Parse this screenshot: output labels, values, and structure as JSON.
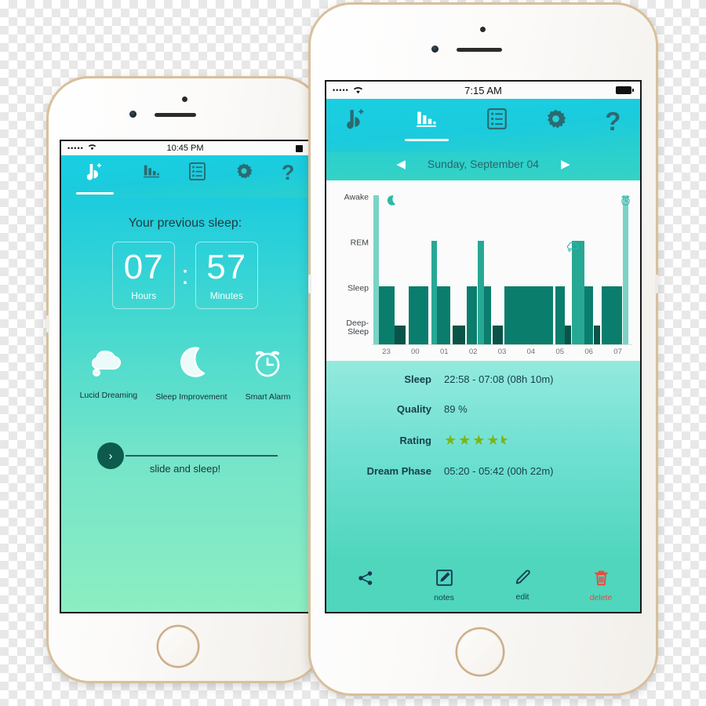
{
  "left_phone": {
    "status_bar": {
      "signal": "•••••",
      "wifi": "wifi-icon",
      "time": "10:45 PM",
      "battery": "battery-icon"
    },
    "nav": {
      "items": [
        {
          "name": "leaf-plus-icon",
          "label": "",
          "active": true
        },
        {
          "name": "bar-chart-icon",
          "label": "",
          "active": false
        },
        {
          "name": "list-icon",
          "label": "",
          "active": false
        },
        {
          "name": "gear-icon",
          "label": "",
          "active": false
        },
        {
          "name": "question-mark-icon",
          "label": "?",
          "active": false
        }
      ]
    },
    "home": {
      "title": "Your previous sleep:",
      "hours_value": "07",
      "hours_unit": "Hours",
      "separator": ":",
      "minutes_value": "57",
      "minutes_unit": "Minutes",
      "features": [
        {
          "icon": "thought-cloud-icon",
          "label": "Lucid Dreaming"
        },
        {
          "icon": "crescent-moon-icon",
          "label": "Sleep Improvement"
        },
        {
          "icon": "alarm-clock-icon",
          "label": "Smart Alarm"
        }
      ],
      "slider_label": "slide and sleep!",
      "slider_knob_icon": "chevron-right-icon"
    }
  },
  "right_phone": {
    "status_bar": {
      "signal": "•••••",
      "wifi": "wifi-icon",
      "time": "7:15 AM",
      "battery": "battery-icon"
    },
    "nav": {
      "items": [
        {
          "name": "leaf-plus-icon",
          "label": "",
          "active": false
        },
        {
          "name": "bar-chart-icon",
          "label": "",
          "active": true
        },
        {
          "name": "list-icon",
          "label": "",
          "active": false
        },
        {
          "name": "gear-icon",
          "label": "",
          "active": false
        },
        {
          "name": "question-mark-icon",
          "label": "?",
          "active": false
        }
      ]
    },
    "date_nav": {
      "prev_icon": "triangle-left-icon",
      "label": "Sunday, September 04",
      "next_icon": "triangle-right-icon"
    },
    "stats": [
      {
        "label": "Sleep",
        "value": "22:58 - 07:08  (08h 10m)",
        "type": "text"
      },
      {
        "label": "Quality",
        "value": "89 %",
        "type": "text"
      },
      {
        "label": "Rating",
        "value": "4.5",
        "type": "stars",
        "stars_full": 4,
        "stars_half": 1,
        "star_color": "#7cb518"
      },
      {
        "label": "Dream Phase",
        "value": "05:20 - 05:42  (00h 22m)",
        "type": "text"
      }
    ],
    "toolbar": [
      {
        "icon": "share-icon",
        "label": "",
        "danger": false
      },
      {
        "icon": "notes-icon",
        "label": "notes",
        "danger": false
      },
      {
        "icon": "pencil-icon",
        "label": "edit",
        "danger": false
      },
      {
        "icon": "trash-icon",
        "label": "delete",
        "danger": true
      }
    ],
    "chart_data": {
      "type": "bar",
      "title": "",
      "xlabel": "",
      "ylabel": "",
      "grid": false,
      "legend": null,
      "y_categories": [
        "Awake",
        "REM",
        "Sleep",
        "Deep-\nSleep"
      ],
      "y_levels": {
        "Awake": 4,
        "REM": 3,
        "Sleep": 2,
        "Deep-Sleep": 1
      },
      "x_ticks": [
        "23",
        "00",
        "01",
        "02",
        "03",
        "04",
        "05",
        "06",
        "07"
      ],
      "x_range": [
        22.9,
        7.25
      ],
      "colors": {
        "awake": "#7ad3c6",
        "rem": "#27a894",
        "sleep": "#0b7d6d",
        "deep": "#0a5348"
      },
      "annotations": [
        {
          "icon": "crescent-moon-icon",
          "x": 23.35,
          "level": "Awake",
          "meaning": "sleep-start"
        },
        {
          "icon": "thought-cloud-icon",
          "x": 5.15,
          "level": "REM",
          "meaning": "dream-phase"
        },
        {
          "icon": "alarm-clock-icon",
          "x": 6.85,
          "level": "Awake",
          "meaning": "alarm"
        }
      ],
      "segments": [
        {
          "start": 22.95,
          "end": 23.12,
          "level": "Awake"
        },
        {
          "start": 23.12,
          "end": 23.62,
          "level": "Sleep"
        },
        {
          "start": 23.62,
          "end": 23.98,
          "level": "Deep-Sleep"
        },
        {
          "start": 0.08,
          "end": 0.72,
          "level": "Sleep"
        },
        {
          "start": 0.8,
          "end": 0.98,
          "level": "REM"
        },
        {
          "start": 0.98,
          "end": 1.42,
          "level": "Sleep"
        },
        {
          "start": 1.48,
          "end": 1.9,
          "level": "Deep-Sleep"
        },
        {
          "start": 1.95,
          "end": 2.28,
          "level": "Sleep"
        },
        {
          "start": 2.3,
          "end": 2.5,
          "level": "REM"
        },
        {
          "start": 2.5,
          "end": 2.72,
          "level": "Sleep"
        },
        {
          "start": 2.78,
          "end": 3.1,
          "level": "Deep-Sleep"
        },
        {
          "start": 3.15,
          "end": 4.7,
          "level": "Sleep"
        },
        {
          "start": 4.78,
          "end": 5.08,
          "level": "Sleep"
        },
        {
          "start": 5.08,
          "end": 5.28,
          "level": "Deep-Sleep"
        },
        {
          "start": 5.32,
          "end": 5.72,
          "level": "REM"
        },
        {
          "start": 5.72,
          "end": 6.0,
          "level": "Sleep"
        },
        {
          "start": 6.02,
          "end": 6.22,
          "level": "Deep-Sleep"
        },
        {
          "start": 6.26,
          "end": 6.92,
          "level": "Sleep"
        },
        {
          "start": 6.95,
          "end": 7.12,
          "level": "Awake"
        }
      ]
    }
  }
}
